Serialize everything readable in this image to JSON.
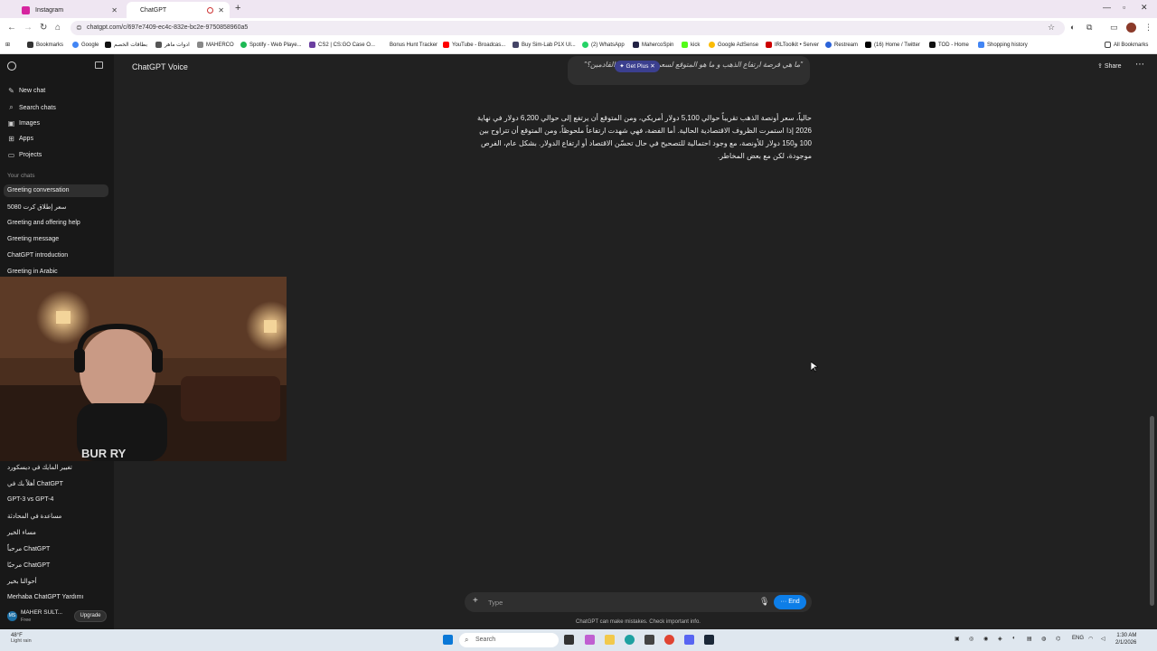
{
  "browser": {
    "tabs": [
      {
        "title": "Instagram",
        "active": false
      },
      {
        "title": "ChatGPT",
        "active": true
      }
    ],
    "url": "chatgpt.com/c/697e7409-ec4c-832e-bc2e-9750858960a5",
    "bookmarks": [
      "Bookmarks",
      "Google",
      "بطاقات الخصم",
      "ادوات ماهر",
      "MAHERCO",
      "Spotify - Web Playe...",
      "CS2 | CS:GO Case O...",
      "Bonus Hunt Tracker",
      "YouTube - Broadcas...",
      "Buy Sim-Lab P1X Ul...",
      "(2) WhatsApp",
      "MahercoSpin",
      "kick",
      "Google AdSense",
      "IRLToolkit • Server",
      "Restream",
      "(16) Home / Twitter",
      "TOD - Home",
      "Shopping history"
    ],
    "all_bookmarks": "All Bookmarks"
  },
  "sidebar": {
    "items": [
      {
        "label": "New chat",
        "icon": "edit-icon"
      },
      {
        "label": "Search chats",
        "icon": "search-icon"
      },
      {
        "label": "Images",
        "icon": "image-icon"
      },
      {
        "label": "Apps",
        "icon": "apps-icon"
      },
      {
        "label": "Projects",
        "icon": "folder-icon"
      }
    ],
    "section_title": "Your chats",
    "chats_top": [
      "Greeting conversation",
      "سعر إطلاق كرت 5080",
      "Greeting and offering help",
      "Greeting message",
      "ChatGPT introduction",
      "Greeting in Arabic"
    ],
    "chats_bottom": [
      "تغيير المايك في ديسكورد",
      "أهلاً بك في ChatGPT",
      "GPT-3 vs GPT-4",
      "مساعدة في المحادثة",
      "مساء الخير",
      "مرحباً ChatGPT",
      "مرحبًا ChatGPT",
      "أحوالنا بخير",
      "Merhaba ChatGPT Yardımı"
    ],
    "user": {
      "name": "MAHER SULT...",
      "plan": "Free",
      "initials": "MS"
    },
    "upgrade_label": "Upgrade"
  },
  "main": {
    "model_title": "ChatGPT Voice",
    "share_label": "Share",
    "user_message": "\"ما هي فرصة ارتفاع الذهب و ما هو المتوقع لسعره في السنتين القادمين؟\"",
    "get_plus_label": "Get Plus",
    "assistant_message": "حالياً، سعر أونصة الذهب تقريباً حوالي 5,100 دولار أمريكي، ومن المتوقع أن يرتفع إلى حوالي 6,200 دولار في نهاية 2026 إذا استمرت الظروف الاقتصادية الحالية. أما الفضة، فهي شهدت ارتفاعاً ملحوظاً، ومن المتوقع أن تتراوح بين 100 و150 دولار للأونصة، مع وجود احتمالية للتصحيح في حال تحسّن الاقتصاد أو ارتفاع الدولار. بشكل عام، الفرص موجودة، لكن مع بعض المخاطر."
  },
  "composer": {
    "placeholder": "Type",
    "end_label": "End",
    "disclaimer": "ChatGPT can make mistakes. Check important info."
  },
  "webcam": {
    "shirt_text": "BUR    RY"
  },
  "taskbar": {
    "weather_temp": "48°F",
    "weather_desc": "Light rain",
    "search_label": "Search",
    "lang": "ENG",
    "time": "1:30 AM",
    "date": "2/1/2026"
  }
}
